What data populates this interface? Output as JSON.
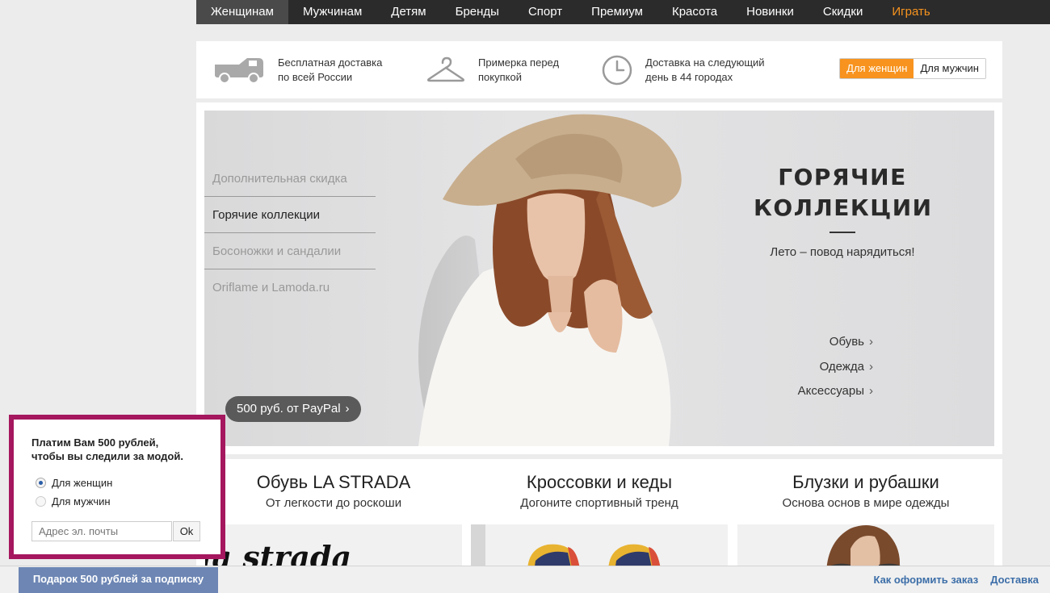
{
  "nav": {
    "items": [
      {
        "label": "Женщинам"
      },
      {
        "label": "Мужчинам"
      },
      {
        "label": "Детям"
      },
      {
        "label": "Бренды"
      },
      {
        "label": "Спорт"
      },
      {
        "label": "Премиум"
      },
      {
        "label": "Красота"
      },
      {
        "label": "Новинки"
      },
      {
        "label": "Скидки"
      },
      {
        "label": "Играть"
      }
    ],
    "active_index": 0,
    "accent_color": "#f7931e"
  },
  "benefits": {
    "items": [
      {
        "icon": "truck-icon",
        "text": "Бесплатная доставка\nпо всей России"
      },
      {
        "icon": "hanger-icon",
        "text": "Примерка перед\nпокупкой"
      },
      {
        "icon": "clock-icon",
        "text": "Доставка на следующий\nдень в 44 городах"
      }
    ],
    "gender_switch": {
      "women": "Для женщин",
      "men": "Для мужчин",
      "selected": "women"
    }
  },
  "hero": {
    "side_menu": [
      {
        "label": "Дополнительная скидка"
      },
      {
        "label": "Горячие коллекции"
      },
      {
        "label": "Босоножки и сандалии"
      },
      {
        "label": "Oriflame и Lamoda.ru"
      }
    ],
    "active_index": 1,
    "title_line1": "ГОРЯЧИЕ",
    "title_line2": "КОЛЛЕКЦИИ",
    "subtitle": "Лето – повод нарядиться!",
    "links": [
      {
        "label": "Обувь"
      },
      {
        "label": "Одежда"
      },
      {
        "label": "Аксессуары"
      }
    ],
    "paypal_label": "500 руб. от PayPal",
    "chevron": "›"
  },
  "promos": [
    {
      "title": "Обувь LA STRADA",
      "subtitle": "От легкости до роскоши",
      "image_text": "la strada"
    },
    {
      "title": "Кроссовки и кеды",
      "subtitle": "Догоните спортивный тренд"
    },
    {
      "title": "Блузки и рубашки",
      "subtitle": "Основа основ в мире одежды"
    }
  ],
  "popup": {
    "title": "Платим Вам 500 рублей,\nчтобы вы следили за модой.",
    "options": [
      {
        "label": "Для женщин",
        "checked": true
      },
      {
        "label": "Для мужчин",
        "checked": false
      }
    ],
    "email_placeholder": "Адрес эл. почты",
    "ok_label": "Ok",
    "border_color": "#a5175e"
  },
  "bottom": {
    "gift_tab": "Подарок 500 рублей за подписку",
    "links": [
      {
        "label": "Как оформить заказ"
      },
      {
        "label": "Доставка"
      }
    ]
  }
}
